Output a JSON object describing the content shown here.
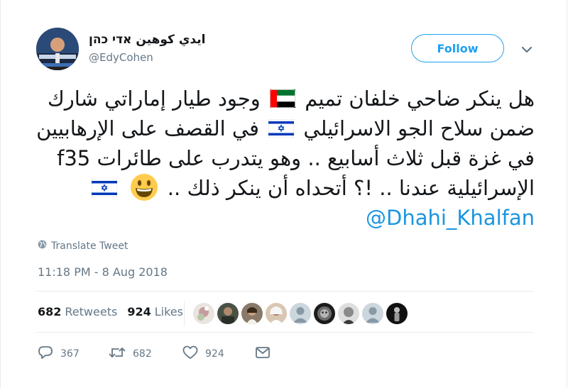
{
  "user": {
    "display_name": "ايدي كوهين אדי כהן",
    "handle": "@EdyCohen",
    "avatar_icon": "profile-photo"
  },
  "follow_button": {
    "label": "Follow"
  },
  "menu": {
    "icon": "chevron-down-icon"
  },
  "tweet": {
    "line1": "هل ينكر ضاحي خلفان تميم",
    "line1b": "وجود طيار إماراتي شارك",
    "line2": "ضمن سلاح الجو الاسرائيلي",
    "line2b": "في القصف على الإرهابيين",
    "line3": "في غزة قبل ثلاث أسابيع .. وهو يتدرب على طائرات f35",
    "line4": "الإسرائيلية عندنا .. !؟ أتحداه أن ينكر ذلك ..",
    "mention": "@Dhahi_Khalfan",
    "flag_uae": "uae-flag-icon",
    "flag_israel": "israel-flag-icon",
    "emoji": "smiling-face-emoji"
  },
  "translate": {
    "label": "Translate Tweet",
    "icon": "globe-icon"
  },
  "timestamp": "11:18 PM - 8 Aug 2018",
  "stats": {
    "retweets_count": "682",
    "retweets_label": "Retweets",
    "likes_count": "924",
    "likes_label": "Likes"
  },
  "actions": {
    "reply_count": "367",
    "retweet_count": "682",
    "like_count": "924"
  },
  "colors": {
    "accent": "#1da1f2",
    "link": "#1b95e0",
    "muted": "#657786",
    "text": "#14171a"
  }
}
